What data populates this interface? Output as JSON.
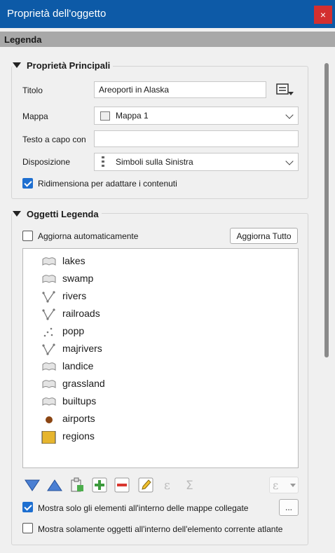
{
  "window": {
    "title": "Proprietà dell'oggetto",
    "close": "×"
  },
  "section": {
    "title": "Legenda"
  },
  "main_props": {
    "title": "Proprietà Principali",
    "titolo_label": "Titolo",
    "titolo_value": "Areoporti in Alaska",
    "mappa_label": "Mappa",
    "mappa_value": "Mappa 1",
    "wrap_label": "Testo a capo con",
    "wrap_value": "",
    "layout_label": "Disposizione",
    "layout_value": "Simboli sulla Sinistra",
    "resize_label": "Ridimensiona per adattare i contenuti",
    "resize_checked": true
  },
  "legend_items": {
    "title": "Oggetti Legenda",
    "auto_update_label": "Aggiorna automaticamente",
    "auto_update_checked": false,
    "update_all_label": "Aggiorna Tutto",
    "items": [
      {
        "label": "lakes",
        "icon": "polygon-icon"
      },
      {
        "label": "swamp",
        "icon": "polygon-icon"
      },
      {
        "label": "rivers",
        "icon": "line-icon"
      },
      {
        "label": "railroads",
        "icon": "line-icon"
      },
      {
        "label": "popp",
        "icon": "point-icon"
      },
      {
        "label": "majrivers",
        "icon": "line-icon"
      },
      {
        "label": "landice",
        "icon": "polygon-icon"
      },
      {
        "label": "grassland",
        "icon": "polygon-icon"
      },
      {
        "label": "builtups",
        "icon": "polygon-icon"
      },
      {
        "label": "airports",
        "icon": "dot-icon",
        "color": "#8b4513"
      },
      {
        "label": "regions",
        "icon": "fill-square-icon",
        "color": "#e6b52e"
      }
    ],
    "only_linked_label": "Mostra solo gli elementi all'interno delle mappe collegate",
    "only_linked_checked": true,
    "more_label": "...",
    "only_atlas_label": "Mostra solamente oggetti all'interno dell'elemento corrente atlante",
    "only_atlas_checked": false
  },
  "colors": {
    "titlebar": "#0d5aa7",
    "close": "#d32f2f",
    "check": "#1e6fd0"
  }
}
